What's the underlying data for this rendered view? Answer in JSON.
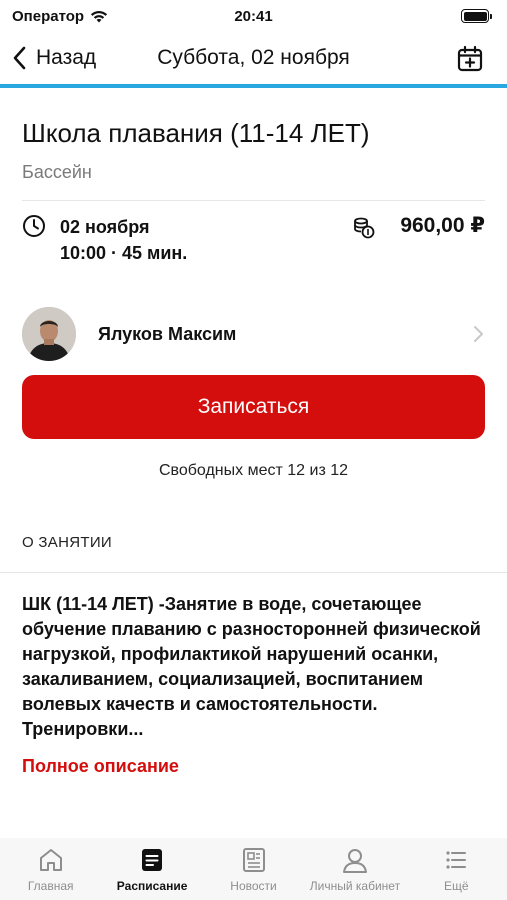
{
  "status_bar": {
    "carrier": "Оператор",
    "time": "20:41"
  },
  "nav": {
    "back_label": "Назад",
    "title": "Суббота, 02 ноября",
    "accent_color": "#29a7e1"
  },
  "event": {
    "title": "Школа плавания (11-14 ЛЕТ)",
    "location": "Бассейн",
    "date": "02 ноября",
    "time": "10:00 · 45 мин.",
    "price": "960,00 ₽"
  },
  "trainer": {
    "name": "Ялуков Максим"
  },
  "signup": {
    "label": "Записаться",
    "color": "#d40d0d"
  },
  "spots_text": "Свободных мест 12 из 12",
  "about": {
    "header": "О ЗАНЯТИИ",
    "description": "ШК (11-14 ЛЕТ) -Занятие в воде, сочетающее обучение плаванию с разносторонней физической нагрузкой, профилактикой нарушений осанки, закаливанием, социализацией, воспитанием волевых качеств и самостоятельности. Тренировки...",
    "full_link": "Полное описание"
  },
  "tabs": [
    {
      "label": "Главная",
      "icon": "home-icon",
      "active": false
    },
    {
      "label": "Расписание",
      "icon": "schedule-icon",
      "active": true
    },
    {
      "label": "Новости",
      "icon": "news-icon",
      "active": false
    },
    {
      "label": "Личный кабинет",
      "icon": "profile-icon",
      "active": false
    },
    {
      "label": "Ещё",
      "icon": "more-icon",
      "active": false
    }
  ]
}
